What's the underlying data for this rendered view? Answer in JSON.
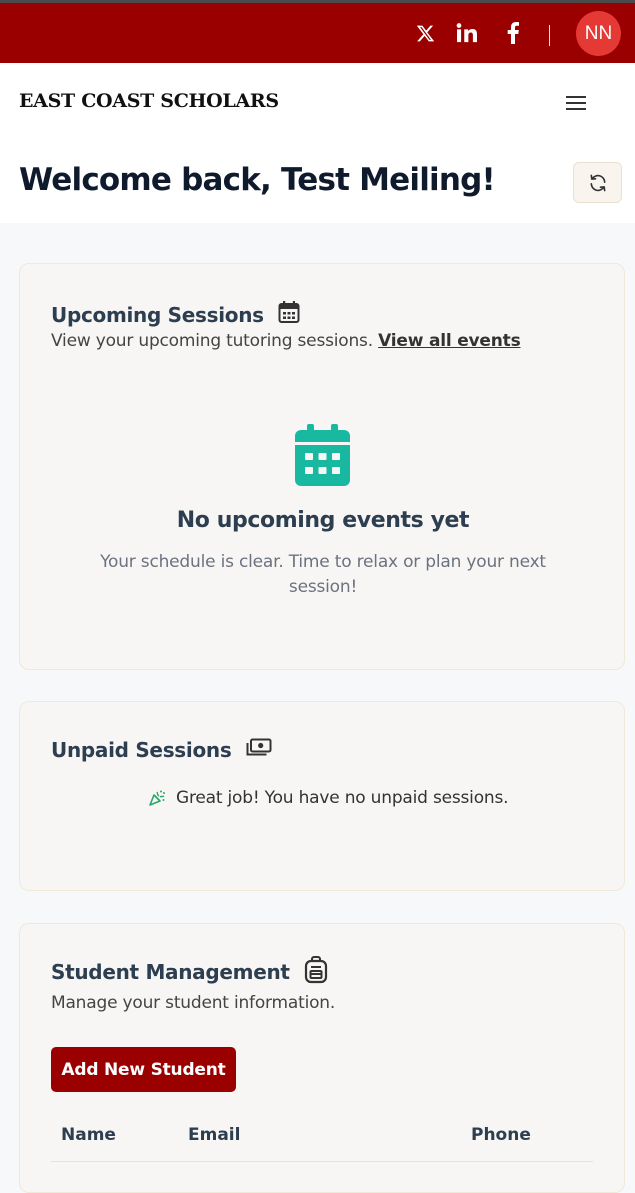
{
  "topbar": {
    "social": [
      "x-icon",
      "linkedin-icon",
      "facebook-icon"
    ],
    "avatar_initials": "NN",
    "color": "#9b0000"
  },
  "navbar": {
    "brand": "EAST COAST SCHOLARS"
  },
  "welcome": {
    "title": "Welcome back, Test Meiling!"
  },
  "upcoming": {
    "title": "Upcoming Sessions",
    "subtitle": "View your upcoming tutoring sessions.",
    "link": "View all events",
    "empty_title": "No upcoming events yet",
    "empty_desc": "Your schedule is clear. Time to relax or plan your next session!",
    "accent": "#19b8a0"
  },
  "unpaid": {
    "title": "Unpaid Sessions",
    "message": "Great job! You have no unpaid sessions."
  },
  "students": {
    "title": "Student Management",
    "subtitle": "Manage your student information.",
    "add_button": "Add New Student",
    "columns": [
      "Name",
      "Email",
      "Phone"
    ]
  }
}
